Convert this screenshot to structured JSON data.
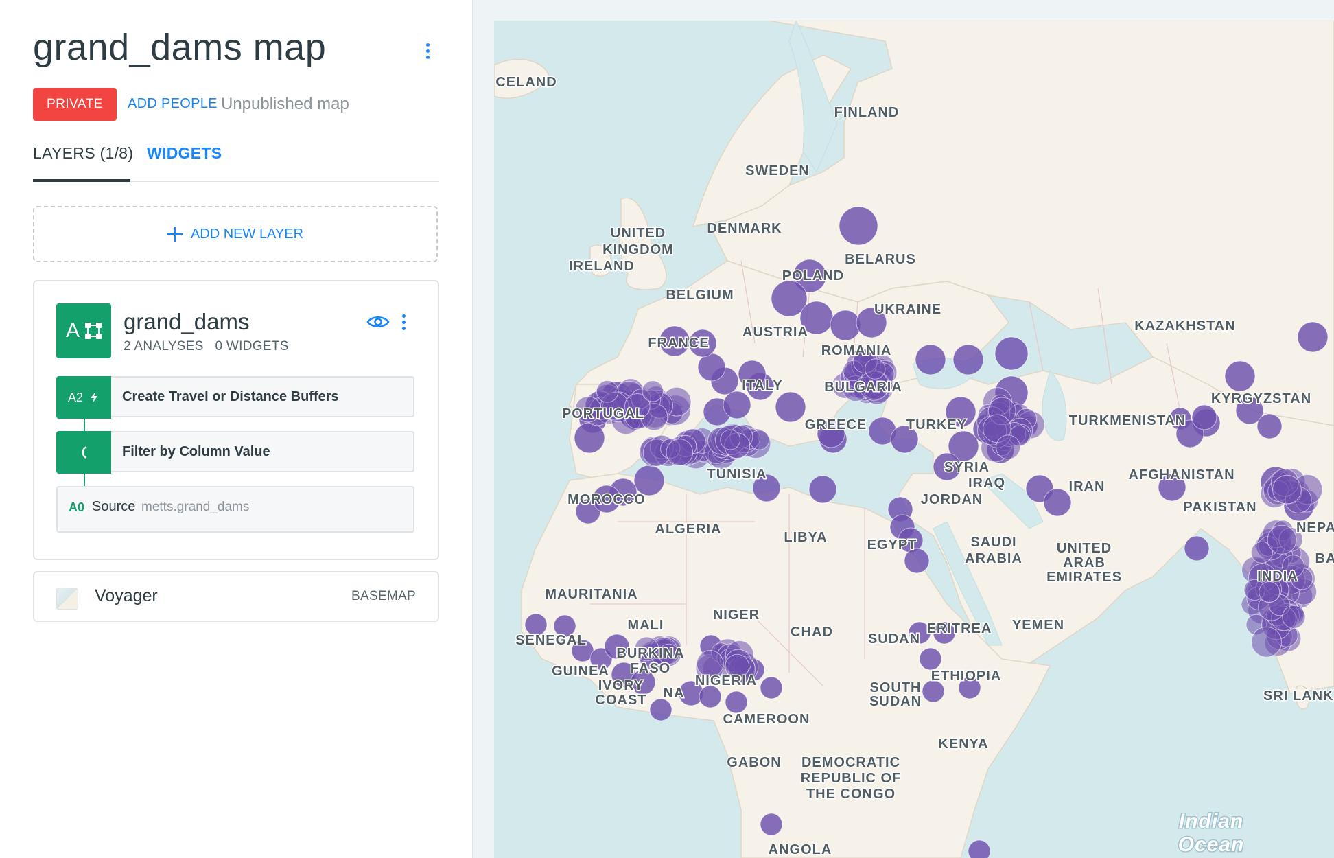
{
  "map": {
    "title": "grand_dams map",
    "privacy": "PRIVATE",
    "add_people": "ADD PEOPLE",
    "status": "Unpublished map"
  },
  "tabs": {
    "layers": "LAYERS (1/8)",
    "widgets": "WIDGETS"
  },
  "add_layer": "ADD NEW LAYER",
  "layer": {
    "letter": "A",
    "name": "grand_dams",
    "analyses": "2 ANALYSES",
    "widgets": "0 WIDGETS",
    "nodes": [
      {
        "id": "A2",
        "label": "Create Travel or Distance Buffers",
        "icon": "lightning-icon"
      },
      {
        "id": "",
        "label": "Filter by Column Value",
        "icon": "filter-icon"
      }
    ],
    "source": {
      "id": "A0",
      "word": "Source",
      "table": "metts.grand_dams"
    }
  },
  "basemap": {
    "name": "Voyager",
    "type": "BASEMAP"
  },
  "colors": {
    "accent": "#1785fb",
    "danger": "#f24440",
    "layer": "#14a06b",
    "point": "#6c4fad"
  },
  "map_labels": {
    "iceland": "CELAND",
    "finland": "FINLAND",
    "sweden": "SWEDEN",
    "denmark": "DENMARK",
    "uk1": "UNITED",
    "uk2": "KINGDOM",
    "ireland": "IRELAND",
    "belarus": "BELARUS",
    "poland": "POLAND",
    "belgium": "BELGIUM",
    "ukraine": "UKRAINE",
    "kazakhstan": "KAZAKHSTAN",
    "austria": "AUSTRIA",
    "france": "FRANCE",
    "romania": "ROMANIA",
    "italy": "ITALY",
    "bulgaria": "BULGARIA",
    "kyrgyzstan": "KYRGYZSTAN",
    "portugal": "PORTUGAL",
    "greece": "GREECE",
    "turkey": "TURKEY",
    "turkmenistan": "TURKMENISTAN",
    "syria": "SYRIA",
    "tunisia": "TUNISIA",
    "iraq": "IRAQ",
    "iran": "IRAN",
    "afghanistan": "AFGHANISTAN",
    "morocco": "MOROCCO",
    "jordan": "JORDAN",
    "pakistan": "PAKISTAN",
    "algeria": "ALGERIA",
    "libya": "LIBYA",
    "egypt": "EGYPT",
    "saudi1": "SAUDI",
    "saudi2": "ARABIA",
    "uae1": "UNITED",
    "uae2": "ARAB",
    "uae3": "EMIRATES",
    "nepal": "NEPA",
    "mauritania": "MAURITANIA",
    "india": "INDIA",
    "mali": "MALI",
    "niger": "NIGER",
    "chad": "CHAD",
    "eritrea": "ERITREA",
    "yemen": "YEMEN",
    "senegal": "SENEGAL",
    "sudan": "SUDAN",
    "burkina1": "BURKINA",
    "burkina2": "FASO",
    "guinea": "GUINEA",
    "ivory1": "IVORY",
    "ivory2": "COAST",
    "ghana": "NA",
    "nigeria": "NIGERIA",
    "ethiopia": "ETHIOPIA",
    "ssudan1": "SOUTH",
    "ssudan2": "SUDAN",
    "srilanka": "SRI LANKA",
    "cameroon": "CAMEROON",
    "kenya": "KENYA",
    "gabon": "GABON",
    "drc1": "DEMOCRATIC",
    "drc2": "REPUBLIC OF",
    "drc3": "THE CONGO",
    "angola": "ANGOLA",
    "ocean1": "Indian",
    "ocean2": "Ocean",
    "ba": "BA"
  }
}
